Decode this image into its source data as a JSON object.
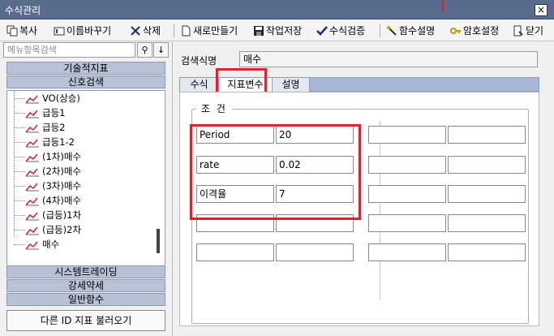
{
  "window": {
    "title": "수식관리",
    "close_glyph": "×"
  },
  "toolbar": {
    "copy": "복사",
    "rename": "이름바꾸기",
    "delete": "삭제",
    "new": "새로만들기",
    "save": "작업저장",
    "verify": "수식검증",
    "func_help": "함수설명",
    "password": "암호설정",
    "close": "닫기"
  },
  "left": {
    "search_placeholder": "메뉴항목검색",
    "search_glyph": "⚲",
    "down_glyph": "↓",
    "categories_top": [
      "기술적지표",
      "신호검색"
    ],
    "tree_items": [
      "VO(상승)",
      "급등1",
      "급등2",
      "급등1-2",
      "(1차)매수",
      "(2차)매수",
      "(3차)매수",
      "(4차)매수",
      "(급등)1차",
      "(급등)2차",
      "매수"
    ],
    "categories_bottom": [
      "시스템트레이딩",
      "강세약세",
      "일반함수"
    ],
    "load_button": "다른 ID 지표 불러오기"
  },
  "right": {
    "name_label": "검색식명",
    "name_value": "매수",
    "tabs": [
      "수식",
      "지표변수",
      "설명"
    ],
    "active_tab": "지표변수",
    "group_title": "조 건",
    "params": [
      {
        "name": "Period",
        "value": "20"
      },
      {
        "name": "rate",
        "value": "0.02"
      },
      {
        "name": "이격율",
        "value": "7"
      },
      {
        "name": "",
        "value": ""
      },
      {
        "name": "",
        "value": ""
      }
    ]
  },
  "colors": {
    "highlight": "#e0202e",
    "titlebar": "#5a6c8e",
    "category": "#b8c2d6",
    "tabbar": "#a7b6d4"
  }
}
